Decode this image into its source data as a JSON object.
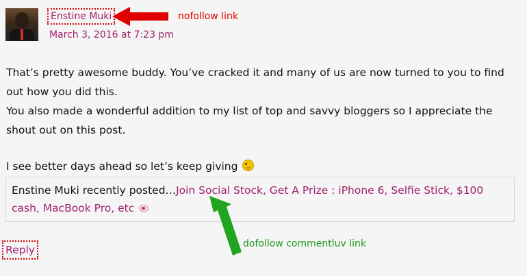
{
  "comment": {
    "author": "Enstine Muki",
    "date": "March 3, 2016 at 7:23 pm",
    "paragraph1_line1": "That’s pretty awesome buddy. You’ve cracked it and many of us are now turned to you to find",
    "paragraph1_line2": "out how you did this.",
    "paragraph2_line1": "You also made a wonderful addition to my list of top and savvy bloggers so I appreciate the",
    "paragraph2_line2": "shout out on this post.",
    "closing": "I see better days ahead so let’s keep giving"
  },
  "commentluv": {
    "prefix": "Enstine Muki recently posted…",
    "link_text": "Join Social Stock, Get A Prize : iPhone 6, Selfie Stick, $100 cash, MacBook Pro, etc"
  },
  "reply_label": "Reply",
  "annotations": {
    "nofollow": "nofollow link",
    "dofollow": "dofollow commentluv link"
  },
  "colors": {
    "link": "#a0206e",
    "annotation_red": "#e00000",
    "annotation_green": "#1b9a1b",
    "background": "#f5f5f5"
  },
  "icons": {
    "emoji": "winking-smiley-icon",
    "commentluv": "heart-icon"
  }
}
